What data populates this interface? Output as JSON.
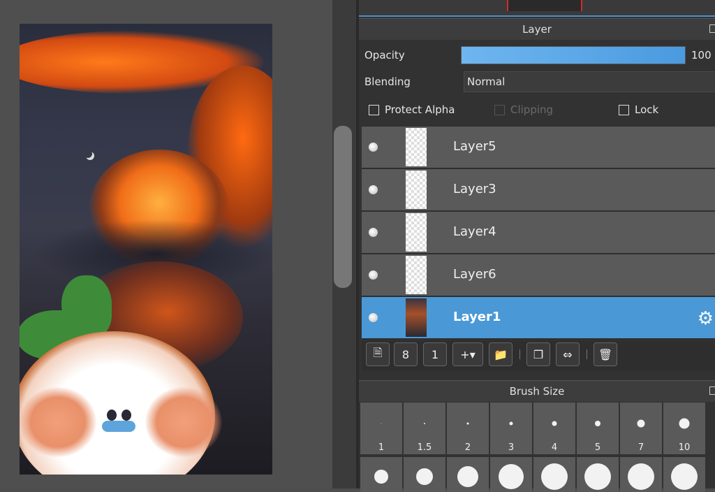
{
  "layer_panel": {
    "title": "Layer",
    "opacity_label": "Opacity",
    "opacity_value": "100",
    "opacity_fraction": 1.0,
    "blending_label": "Blending",
    "blending_value": "Normal",
    "checkboxes": {
      "protect_alpha": "Protect Alpha",
      "clipping": "Clipping",
      "lock": "Lock"
    },
    "layers": [
      {
        "name": "Layer5",
        "selected": false
      },
      {
        "name": "Layer3",
        "selected": false
      },
      {
        "name": "Layer4",
        "selected": false
      },
      {
        "name": "Layer6",
        "selected": false
      },
      {
        "name": "Layer1",
        "selected": true
      }
    ]
  },
  "brush_panel": {
    "title": "Brush Size",
    "sizes": [
      "1",
      "1.5",
      "2",
      "3",
      "4",
      "5",
      "7",
      "10"
    ]
  },
  "icons": {
    "gear": "gear-icon",
    "new_layer": "new-layer-icon",
    "new_8bit_layer": "new-8bit-layer-icon",
    "new_1bit_layer": "new-1bit-layer-icon",
    "add_layer_menu": "add-layer-menu-icon",
    "folder": "folder-icon",
    "duplicate": "duplicate-layer-icon",
    "merge": "merge-layer-icon",
    "delete": "delete-layer-icon"
  },
  "colors": {
    "selection": "#4a98d6",
    "panel_bg": "#323232",
    "row_bg": "#5a5a5a"
  }
}
